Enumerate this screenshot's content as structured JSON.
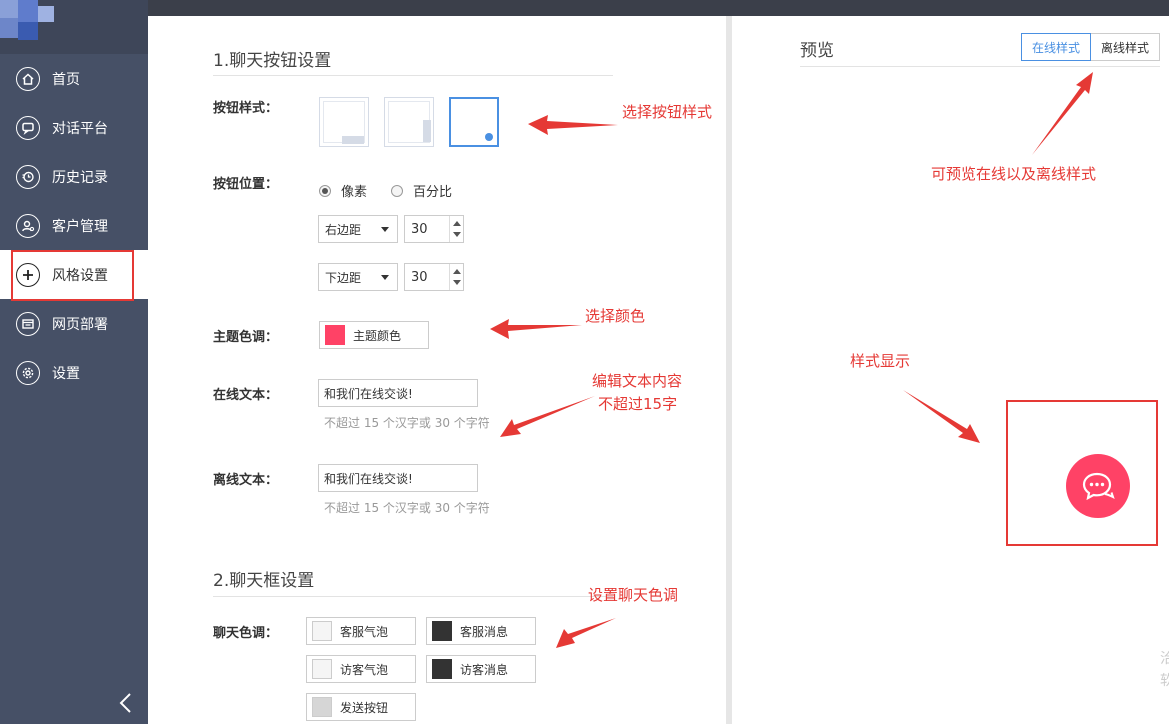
{
  "sidebar": {
    "items": [
      {
        "label": "首页",
        "icon": "home-icon"
      },
      {
        "label": "对话平台",
        "icon": "chat-icon"
      },
      {
        "label": "历史记录",
        "icon": "history-icon"
      },
      {
        "label": "客户管理",
        "icon": "customer-icon"
      },
      {
        "label": "风格设置",
        "icon": "plus-icon"
      },
      {
        "label": "网页部署",
        "icon": "deploy-icon"
      },
      {
        "label": "设置",
        "icon": "gear-icon"
      }
    ],
    "active_index": 4
  },
  "section1": {
    "title": "1.聊天按钮设置",
    "style_label": "按钮样式：",
    "position_label": "按钮位置：",
    "radio_pixel": "像素",
    "radio_percent": "百分比",
    "right_margin_label": "右边距",
    "right_margin_value": "30",
    "bottom_margin_label": "下边距",
    "bottom_margin_value": "30",
    "theme_label": "主题色调：",
    "theme_btn": "主题颜色",
    "online_label": "在线文本：",
    "online_value": "和我们在线交谈!",
    "online_hint": "不超过 15 个汉字或 30 个字符",
    "offline_label": "离线文本：",
    "offline_value": "和我们在线交谈!",
    "offline_hint": "不超过 15 个汉字或 30 个字符"
  },
  "section2": {
    "title": "2.聊天框设置",
    "color_label": "聊天色调：",
    "buttons": [
      "客服气泡",
      "客服消息",
      "访客气泡",
      "访客消息",
      "发送按钮"
    ]
  },
  "annotations": {
    "a1": "选择按钮样式",
    "a2": "选择颜色",
    "a3_line1": "编辑文本内容",
    "a3_line2": "不超过15字",
    "a4": "设置聊天色调",
    "a5": "可预览在线以及离线样式",
    "a6": "样式显示"
  },
  "preview": {
    "title": "预览",
    "tab_online": "在线样式",
    "tab_offline": "离线样式"
  },
  "colors": {
    "theme": "#ff4266",
    "accent": "#4a90e2",
    "annotation": "#e53935",
    "sidebar": "#465066"
  },
  "edge_text": "洽软"
}
